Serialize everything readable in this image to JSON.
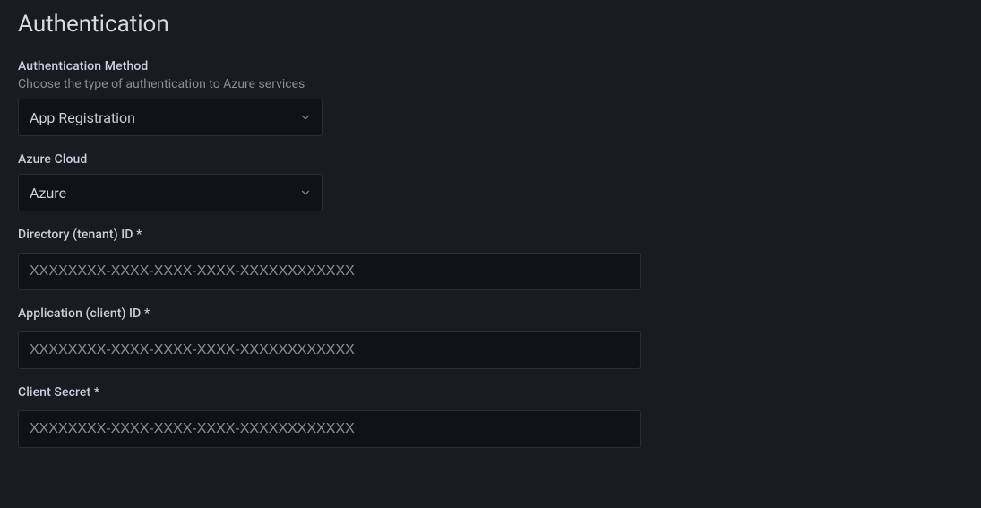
{
  "section": {
    "title": "Authentication"
  },
  "authMethod": {
    "label": "Authentication Method",
    "description": "Choose the type of authentication to Azure services",
    "value": "App Registration"
  },
  "azureCloud": {
    "label": "Azure Cloud",
    "value": "Azure"
  },
  "tenantId": {
    "label": "Directory (tenant) ID *",
    "placeholder": "XXXXXXXX-XXXX-XXXX-XXXX-XXXXXXXXXXXX",
    "value": ""
  },
  "clientId": {
    "label": "Application (client) ID *",
    "placeholder": "XXXXXXXX-XXXX-XXXX-XXXX-XXXXXXXXXXXX",
    "value": ""
  },
  "clientSecret": {
    "label": "Client Secret *",
    "placeholder": "XXXXXXXX-XXXX-XXXX-XXXX-XXXXXXXXXXXX",
    "value": ""
  }
}
